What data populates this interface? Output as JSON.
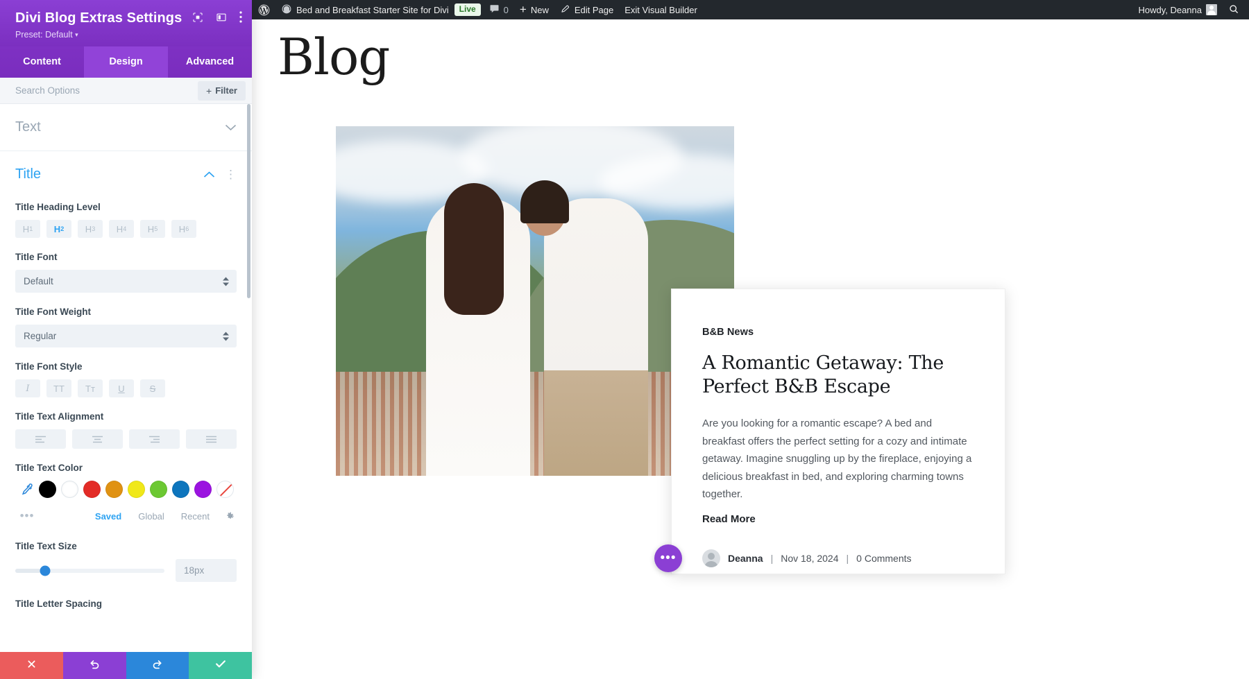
{
  "adminbar": {
    "wp_logo_icon": "wordpress-logo-icon",
    "site_icon": "dashboard-icon",
    "site_name": "Bed and Breakfast Starter Site for Divi",
    "live_badge": "Live",
    "comments_icon": "comment-bubble-icon",
    "comment_count": "0",
    "new_label": "New",
    "edit_page_label": "Edit Page",
    "edit_page_icon": "pencil-icon",
    "exit_builder_label": "Exit Visual Builder",
    "howdy": "Howdy, Deanna",
    "avatar_icon": "user-avatar-icon",
    "search_icon": "search-icon"
  },
  "panel": {
    "title": "Divi Blog Extras Settings",
    "preset_label": "Preset: Default",
    "preset_caret": "▾",
    "header_icons": [
      "responsive-preview-icon",
      "layout-toggle-icon",
      "more-vertical-icon"
    ],
    "tabs": [
      {
        "label": "Content",
        "active": false
      },
      {
        "label": "Design",
        "active": true
      },
      {
        "label": "Advanced",
        "active": false
      }
    ],
    "search_placeholder": "Search Options",
    "search_value": "",
    "filter_label": "Filter",
    "filter_plus": "+",
    "sections": {
      "text": {
        "label": "Text",
        "open": false,
        "chevron": "chevron-down-icon"
      },
      "title": {
        "label": "Title",
        "open": true,
        "chevron": "chevron-up-icon",
        "menu": "⋮"
      }
    },
    "options": {
      "heading_level": {
        "label": "Title Heading Level",
        "items": [
          {
            "label": "H",
            "sub": "1",
            "active": false
          },
          {
            "label": "H",
            "sub": "2",
            "active": true
          },
          {
            "label": "H",
            "sub": "3",
            "active": false
          },
          {
            "label": "H",
            "sub": "4",
            "active": false
          },
          {
            "label": "H",
            "sub": "5",
            "active": false
          },
          {
            "label": "H",
            "sub": "6",
            "active": false
          }
        ]
      },
      "title_font": {
        "label": "Title Font",
        "value": "Default"
      },
      "title_font_weight": {
        "label": "Title Font Weight",
        "value": "Regular"
      },
      "title_font_style": {
        "label": "Title Font Style",
        "items": [
          {
            "name": "italic",
            "glyph": "I"
          },
          {
            "name": "uppercase",
            "glyph": "TT"
          },
          {
            "name": "small-caps",
            "glyph": "Tᴛ"
          },
          {
            "name": "underline",
            "glyph": "U"
          },
          {
            "name": "strikethrough",
            "glyph": "S"
          }
        ]
      },
      "title_text_alignment": {
        "label": "Title Text Alignment",
        "items": [
          "align-left",
          "align-center",
          "align-right",
          "align-justify"
        ]
      },
      "title_text_color": {
        "label": "Title Text Color",
        "eyedropper_icon": "eyedropper-icon",
        "swatches": [
          "#000000",
          "#ffffff",
          "#e32b26",
          "#e09213",
          "#f0e819",
          "#6cc832",
          "#0d75bd",
          "#9b13e0",
          "none"
        ],
        "more_icon": "more-horizontal-icon",
        "tabs": [
          {
            "label": "Saved",
            "active": true
          },
          {
            "label": "Global",
            "active": false
          },
          {
            "label": "Recent",
            "active": false
          }
        ],
        "gear_icon": "gear-icon"
      },
      "title_text_size": {
        "label": "Title Text Size",
        "value": "18px",
        "slider_percent": 20
      },
      "title_letter_spacing": {
        "label": "Title Letter Spacing"
      }
    },
    "footer": [
      {
        "name": "cancel",
        "icon": "close-icon",
        "color": "#eb5c5c"
      },
      {
        "name": "undo",
        "icon": "undo-icon",
        "color": "#8b3fd4"
      },
      {
        "name": "redo",
        "icon": "redo-icon",
        "color": "#2b87da"
      },
      {
        "name": "save",
        "icon": "check-icon",
        "color": "#3ec3a0"
      }
    ]
  },
  "page": {
    "heading": "Blog",
    "post": {
      "category": "B&B News",
      "title": "A Romantic Getaway: The Perfect B&B Escape",
      "excerpt": "Are you looking for a romantic escape? A bed and breakfast offers the perfect setting for a cozy and intimate getaway. Imagine snuggling up by the fireplace, enjoying a delicious breakfast in bed, and exploring charming towns together.",
      "read_more": "Read More",
      "author": "Deanna",
      "date": "Nov 18, 2024",
      "comments": "0 Comments",
      "separator": "|",
      "image_alt": "couple-embracing-on-hillside-photo"
    },
    "fab_icon": "more-horizontal-icon",
    "fab_label": "•••"
  }
}
